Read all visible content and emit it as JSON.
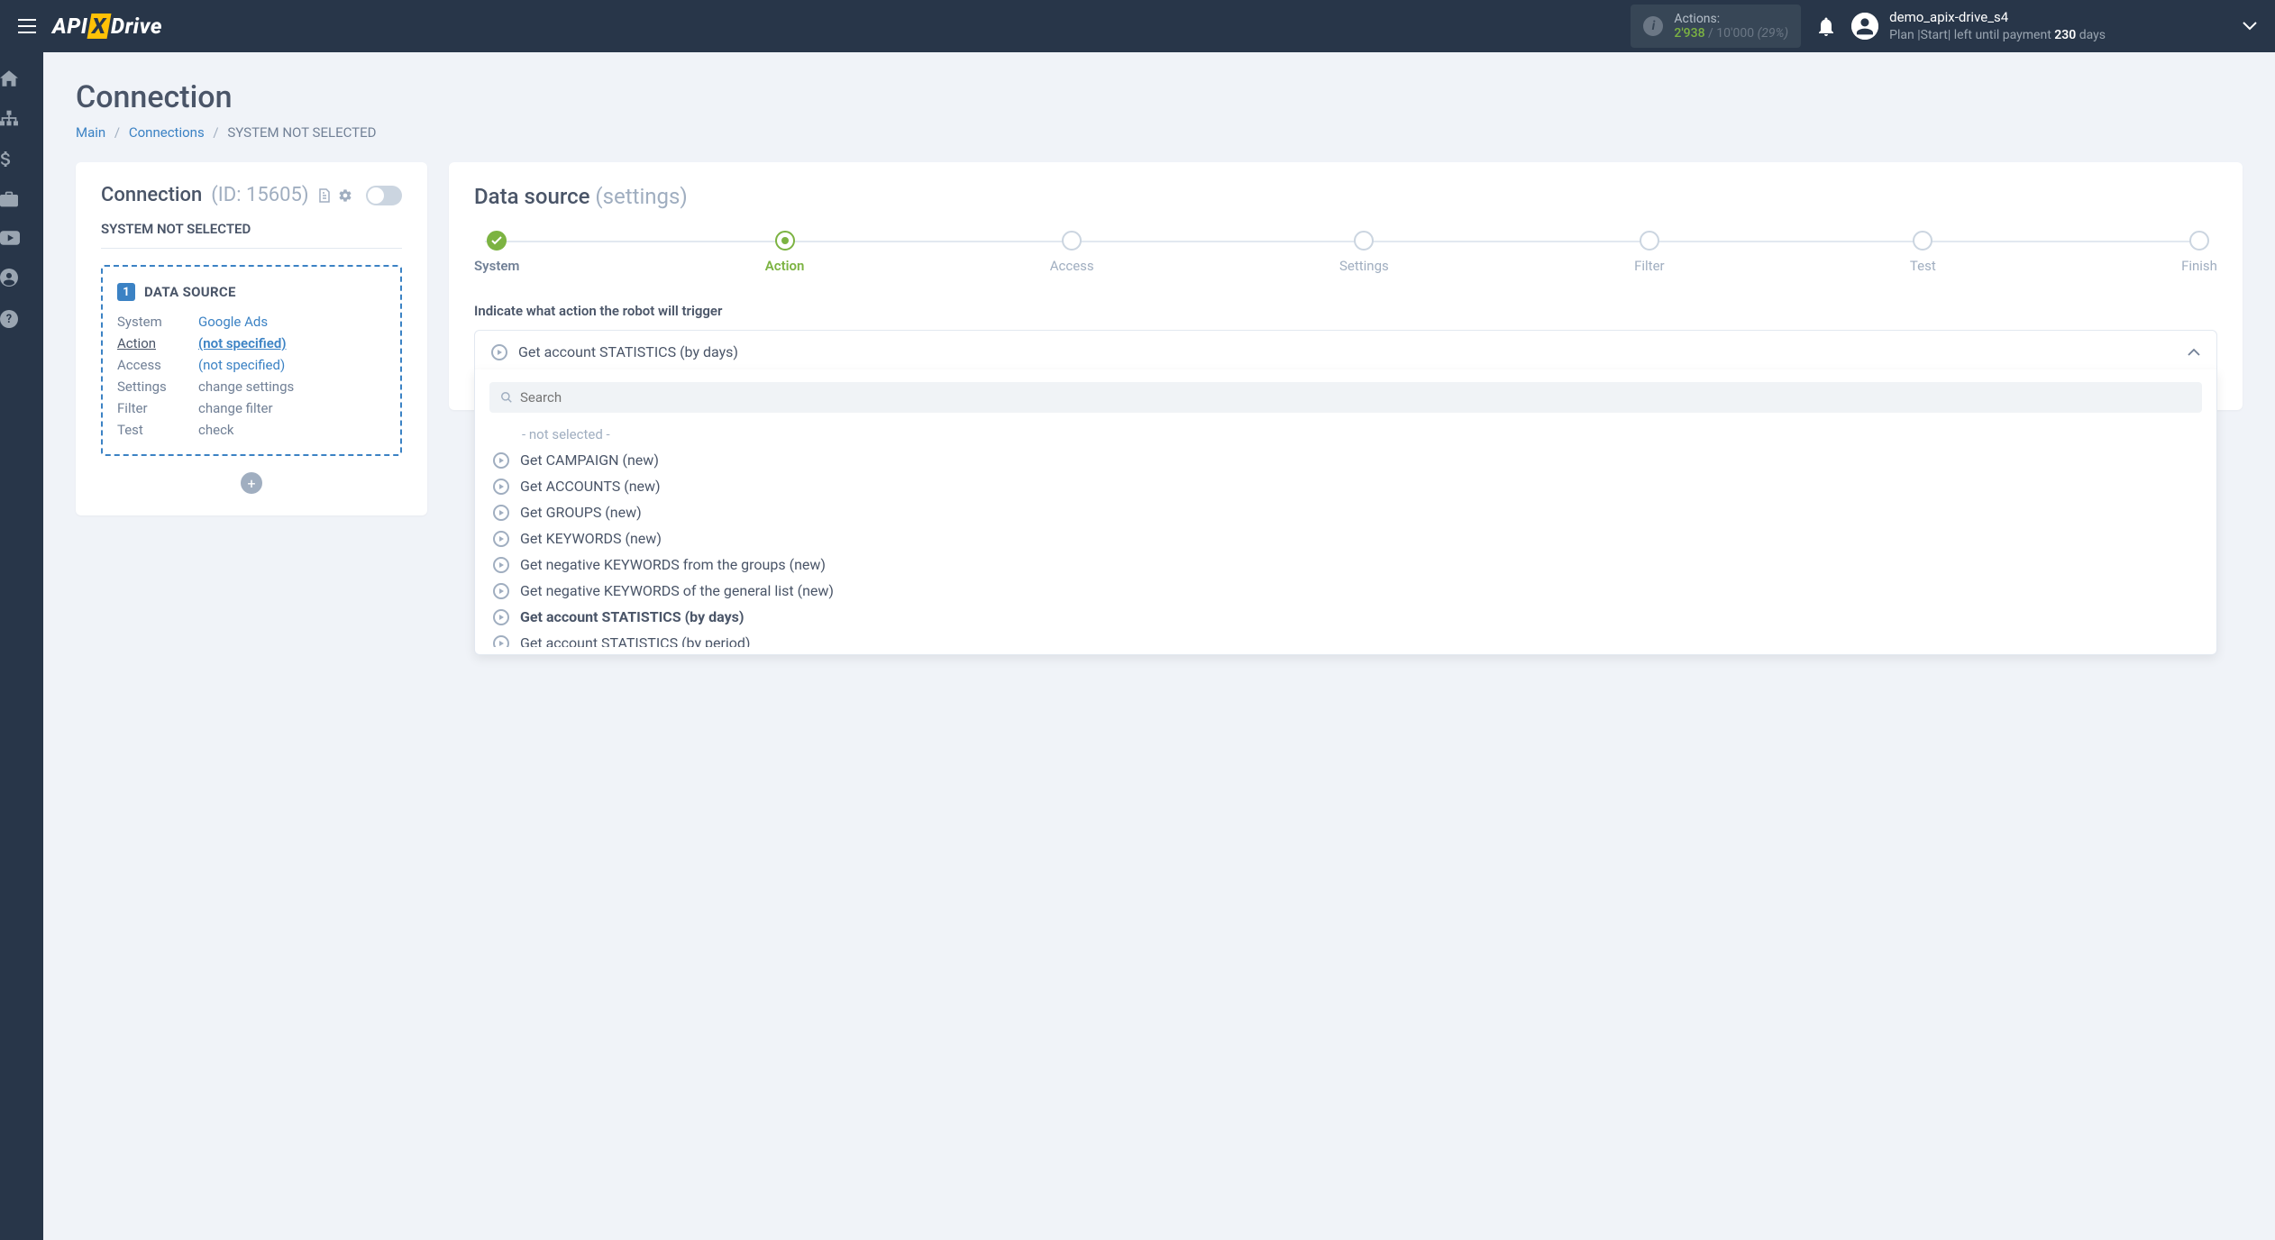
{
  "header": {
    "actions_label": "Actions:",
    "actions_used": "2'938",
    "actions_total": "10'000",
    "actions_pct": "(29%)",
    "user_name": "demo_apix-drive_s4",
    "plan_prefix": "Plan |Start| left until payment ",
    "plan_days": "230",
    "plan_suffix": " days"
  },
  "page": {
    "title": "Connection",
    "breadcrumb": {
      "main": "Main",
      "connections": "Connections",
      "current": "SYSTEM NOT SELECTED"
    }
  },
  "left": {
    "title": "Connection",
    "id_label": "(ID: 15605)",
    "sys_not": "SYSTEM NOT SELECTED",
    "ds_badge": "1",
    "ds_label": "DATA SOURCE",
    "rows": {
      "system_k": "System",
      "system_v": "Google Ads",
      "action_k": "Action",
      "action_v": "(not specified)",
      "access_k": "Access",
      "access_v": "(not specified)",
      "settings_k": "Settings",
      "settings_v": "change settings",
      "filter_k": "Filter",
      "filter_v": "change filter",
      "test_k": "Test",
      "test_v": "check"
    }
  },
  "right": {
    "heading_main": "Data source",
    "heading_sub": "(settings)",
    "steps": [
      "System",
      "Action",
      "Access",
      "Settings",
      "Filter",
      "Test",
      "Finish"
    ],
    "form_label": "Indicate what action the robot will trigger",
    "selected": "Get account STATISTICS (by days)",
    "search_placeholder": "Search",
    "placeholder_option": "- not selected -",
    "options": [
      "Get CAMPAIGN (new)",
      "Get ACCOUNTS (new)",
      "Get GROUPS (new)",
      "Get KEYWORDS (new)",
      "Get negative KEYWORDS from the groups (new)",
      "Get negative KEYWORDS of the general list (new)",
      "Get account STATISTICS (by days)",
      "Get account STATISTICS (by period)"
    ],
    "selected_index": 6
  }
}
